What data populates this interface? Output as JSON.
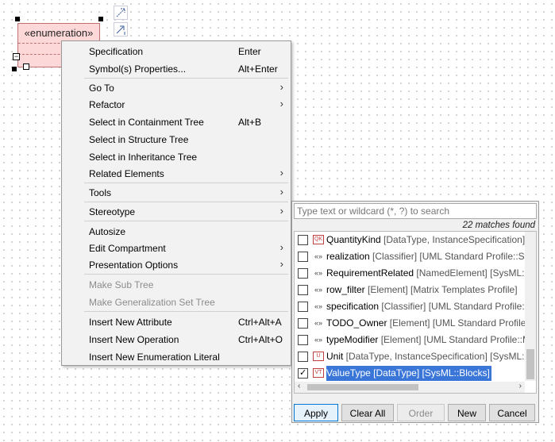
{
  "diagram": {
    "element_stereotype": "«enumeration»",
    "collapse_glyph": "−"
  },
  "context_menu": {
    "items": [
      {
        "label": "Specification",
        "shortcut": "Enter"
      },
      {
        "label": "Symbol(s) Properties...",
        "shortcut": "Alt+Enter"
      },
      {
        "label": "Go To",
        "submenu": true
      },
      {
        "label": "Refactor",
        "submenu": true
      },
      {
        "label": "Select in Containment Tree",
        "shortcut": "Alt+B"
      },
      {
        "label": "Select in Structure Tree"
      },
      {
        "label": "Select in Inheritance Tree"
      },
      {
        "label": "Related Elements",
        "submenu": true
      },
      {
        "label": "Tools",
        "submenu": true
      },
      {
        "label": "Stereotype",
        "submenu": true
      },
      {
        "label": "Autosize"
      },
      {
        "label": "Edit Compartment",
        "submenu": true
      },
      {
        "label": "Presentation Options",
        "submenu": true
      },
      {
        "label": "Make Sub Tree",
        "disabled": true
      },
      {
        "label": "Make Generalization Set Tree",
        "disabled": true
      },
      {
        "label": "Insert New Attribute",
        "shortcut": "Ctrl+Alt+A"
      },
      {
        "label": "Insert New Operation",
        "shortcut": "Ctrl+Alt+O"
      },
      {
        "label": "Insert New Enumeration Literal"
      }
    ],
    "submenu_arrow": "›"
  },
  "stereotype_popup": {
    "search_placeholder": "Type text or wildcard (*, ?) to search",
    "matches_label": "22 matches found",
    "rows": [
      {
        "name": "QuantityKind",
        "meta": " [DataType, InstanceSpecification] [SysML::Blocks]",
        "icon": "datatype-icon",
        "icon_glyph": "QK",
        "checked": false
      },
      {
        "name": "realization",
        "meta": " [Classifier] [UML Standard Profile::Standard]",
        "icon": "stereotype-icon",
        "icon_glyph": "«»",
        "checked": false
      },
      {
        "name": "RequirementRelated",
        "meta": " [NamedElement] [SysML::Requirements]",
        "icon": "stereotype-icon",
        "icon_glyph": "«»",
        "checked": false
      },
      {
        "name": "row_filter",
        "meta": " [Element] [Matrix Templates Profile]",
        "icon": "stereotype-icon",
        "icon_glyph": "«»",
        "checked": false
      },
      {
        "name": "specification",
        "meta": " [Classifier] [UML Standard Profile::Standard]",
        "icon": "stereotype-icon",
        "icon_glyph": "«»",
        "checked": false
      },
      {
        "name": "TODO_Owner",
        "meta": " [Element] [UML Standard Profile::MagicDraw]",
        "icon": "stereotype-icon",
        "icon_glyph": "«»",
        "checked": false
      },
      {
        "name": "typeModifier",
        "meta": " [Element] [UML Standard Profile::MagicDraw]",
        "icon": "stereotype-icon",
        "icon_glyph": "«»",
        "checked": false
      },
      {
        "name": "Unit",
        "meta": " [DataType, InstanceSpecification] [SysML::Blocks]",
        "icon": "datatype-icon",
        "icon_glyph": "U",
        "checked": false
      },
      {
        "name": "ValueType",
        "meta": " [DataType] [SysML::Blocks]",
        "icon": "datatype-icon",
        "icon_glyph": "VT",
        "checked": true,
        "selected": true
      }
    ],
    "buttons": {
      "apply": "Apply",
      "clear_all": "Clear All",
      "order": "Order",
      "new": "New",
      "cancel": "Cancel"
    },
    "scroll_left_glyph": "‹",
    "scroll_right_glyph": "›"
  }
}
